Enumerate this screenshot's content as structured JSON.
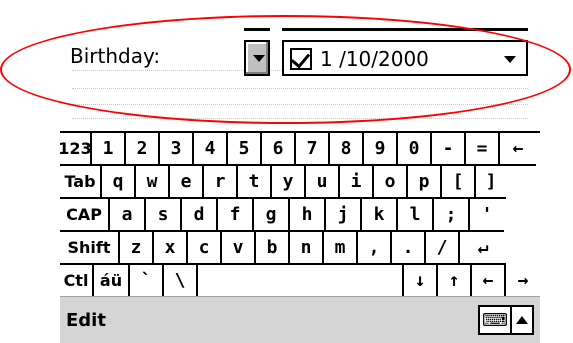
{
  "form": {
    "birthday_label": "Birthday:",
    "date_value": "1 /10/2000",
    "date_checked": true
  },
  "keyboard": {
    "rows": [
      [
        "123",
        "1",
        "2",
        "3",
        "4",
        "5",
        "6",
        "7",
        "8",
        "9",
        "0",
        "-",
        "=",
        "←"
      ],
      [
        "Tab",
        "q",
        "w",
        "e",
        "r",
        "t",
        "y",
        "u",
        "i",
        "o",
        "p",
        "[",
        "]"
      ],
      [
        "CAP",
        "a",
        "s",
        "d",
        "f",
        "g",
        "h",
        "j",
        "k",
        "l",
        ";",
        "'"
      ],
      [
        "Shift",
        "z",
        "x",
        "c",
        "v",
        "b",
        "n",
        "m",
        ",",
        ".",
        "/",
        "↵"
      ],
      [
        "Ctl",
        "áü",
        "`",
        "\\",
        " ",
        "↓",
        "↑",
        "←",
        "→"
      ]
    ]
  },
  "menubar": {
    "edit_label": "Edit",
    "sip_icon": "keyboard-icon"
  },
  "colors": {
    "highlight": "#ff0000"
  }
}
